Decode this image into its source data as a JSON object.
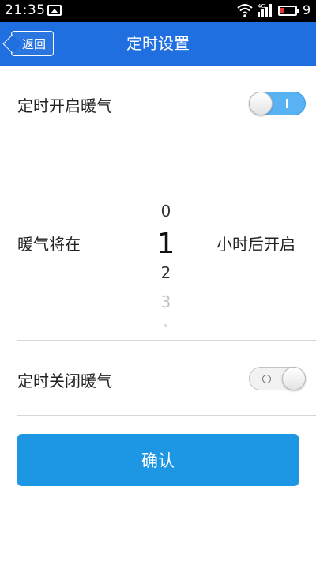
{
  "status_bar": {
    "time": "21:35",
    "network_label": "4G",
    "battery_level": "9",
    "icons": [
      "image-icon",
      "wifi-icon",
      "signal-icon",
      "battery-icon"
    ]
  },
  "header": {
    "back_label": "返回",
    "title": "定时设置",
    "color": "#1f6fe0"
  },
  "timer_on": {
    "label": "定时开启暖气",
    "toggle_state": "on"
  },
  "delay_picker": {
    "prefix": "暖气将在",
    "suffix": "小时后开启",
    "options": [
      "0",
      "1",
      "2",
      "3"
    ],
    "selected": "1"
  },
  "timer_off": {
    "label": "定时关闭暖气",
    "toggle_state": "off"
  },
  "confirm": {
    "label": "确认",
    "color": "#1d96e4"
  }
}
